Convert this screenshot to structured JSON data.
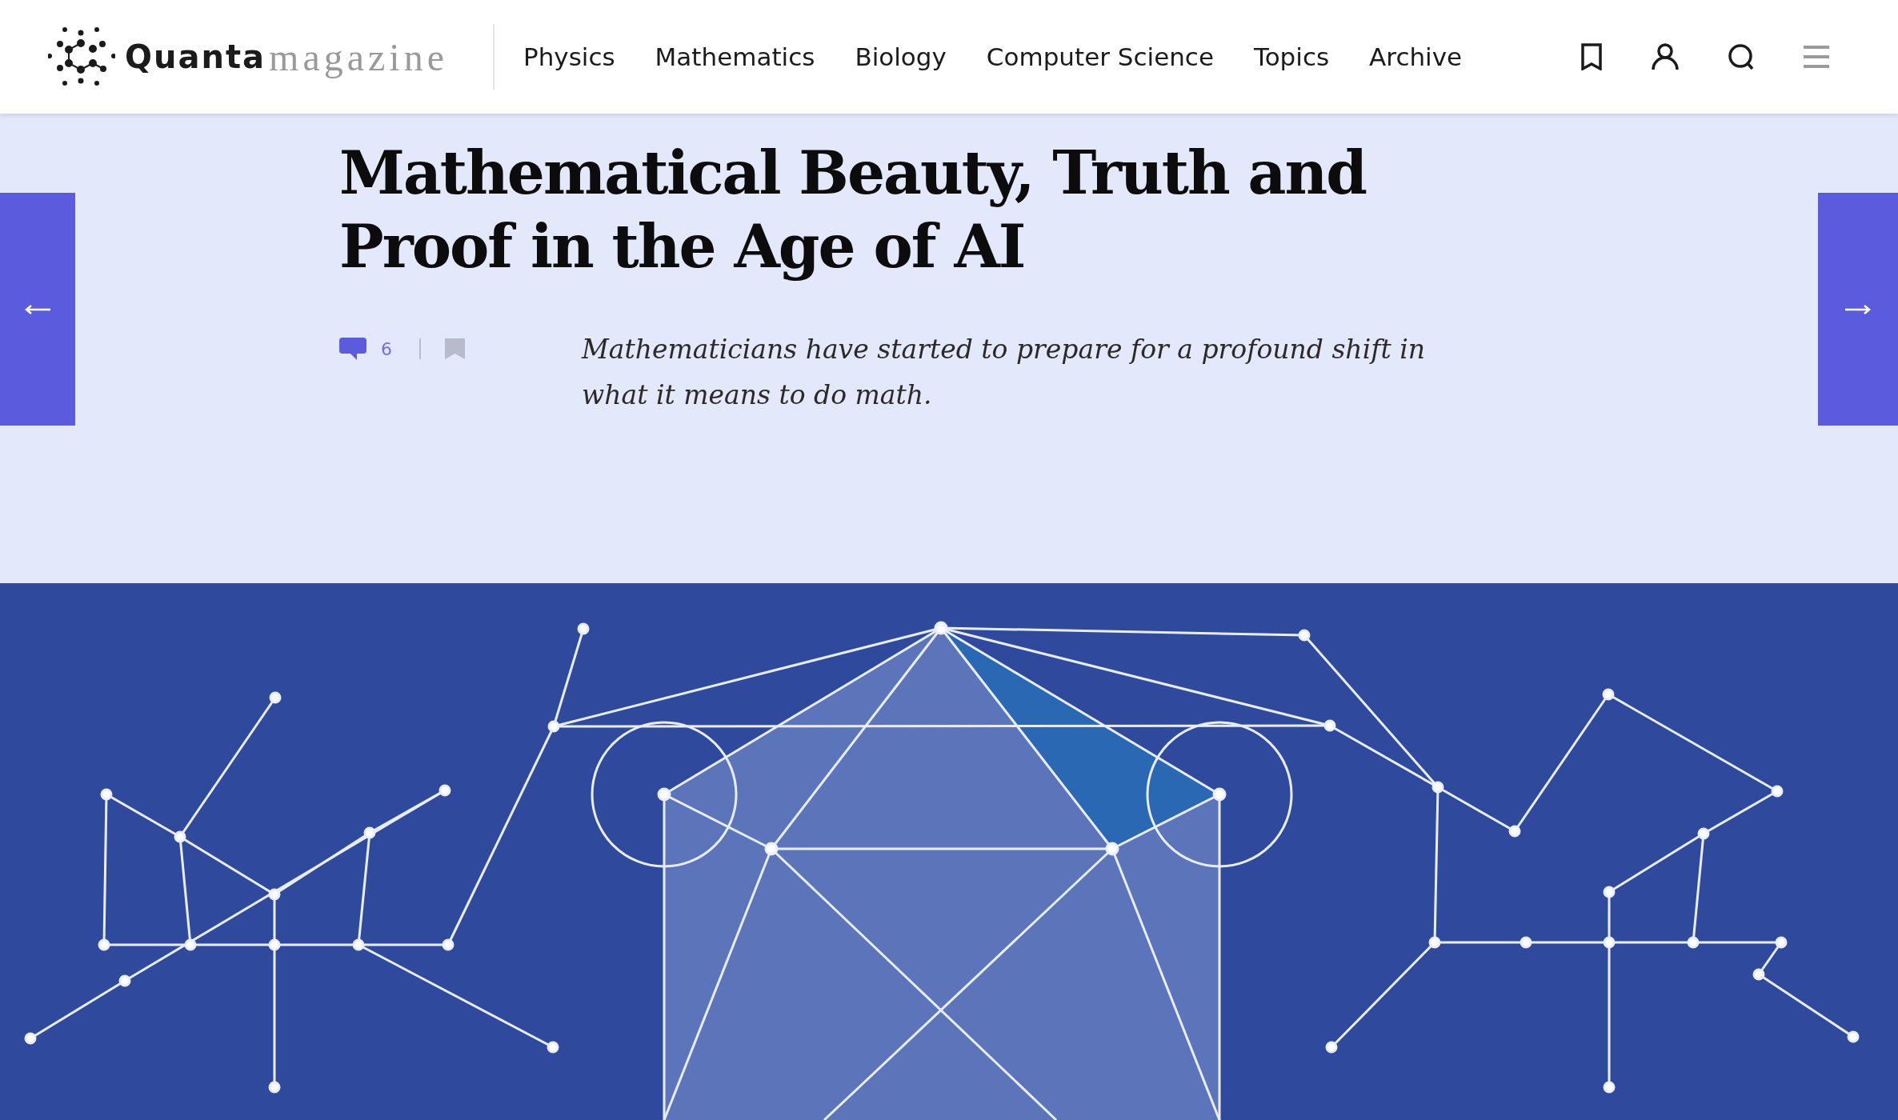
{
  "header": {
    "logo": {
      "primary": "Quanta",
      "secondary": "magazine"
    },
    "nav": [
      {
        "label": "Physics"
      },
      {
        "label": "Mathematics"
      },
      {
        "label": "Biology"
      },
      {
        "label": "Computer Science"
      },
      {
        "label": "Topics"
      },
      {
        "label": "Archive"
      }
    ]
  },
  "article": {
    "title": "Mathematical Beauty, Truth and Proof in the Age of AI",
    "comment_count": "6",
    "summary": "Mathematicians have started to prepare for a profound shift in what it means to do math."
  }
}
